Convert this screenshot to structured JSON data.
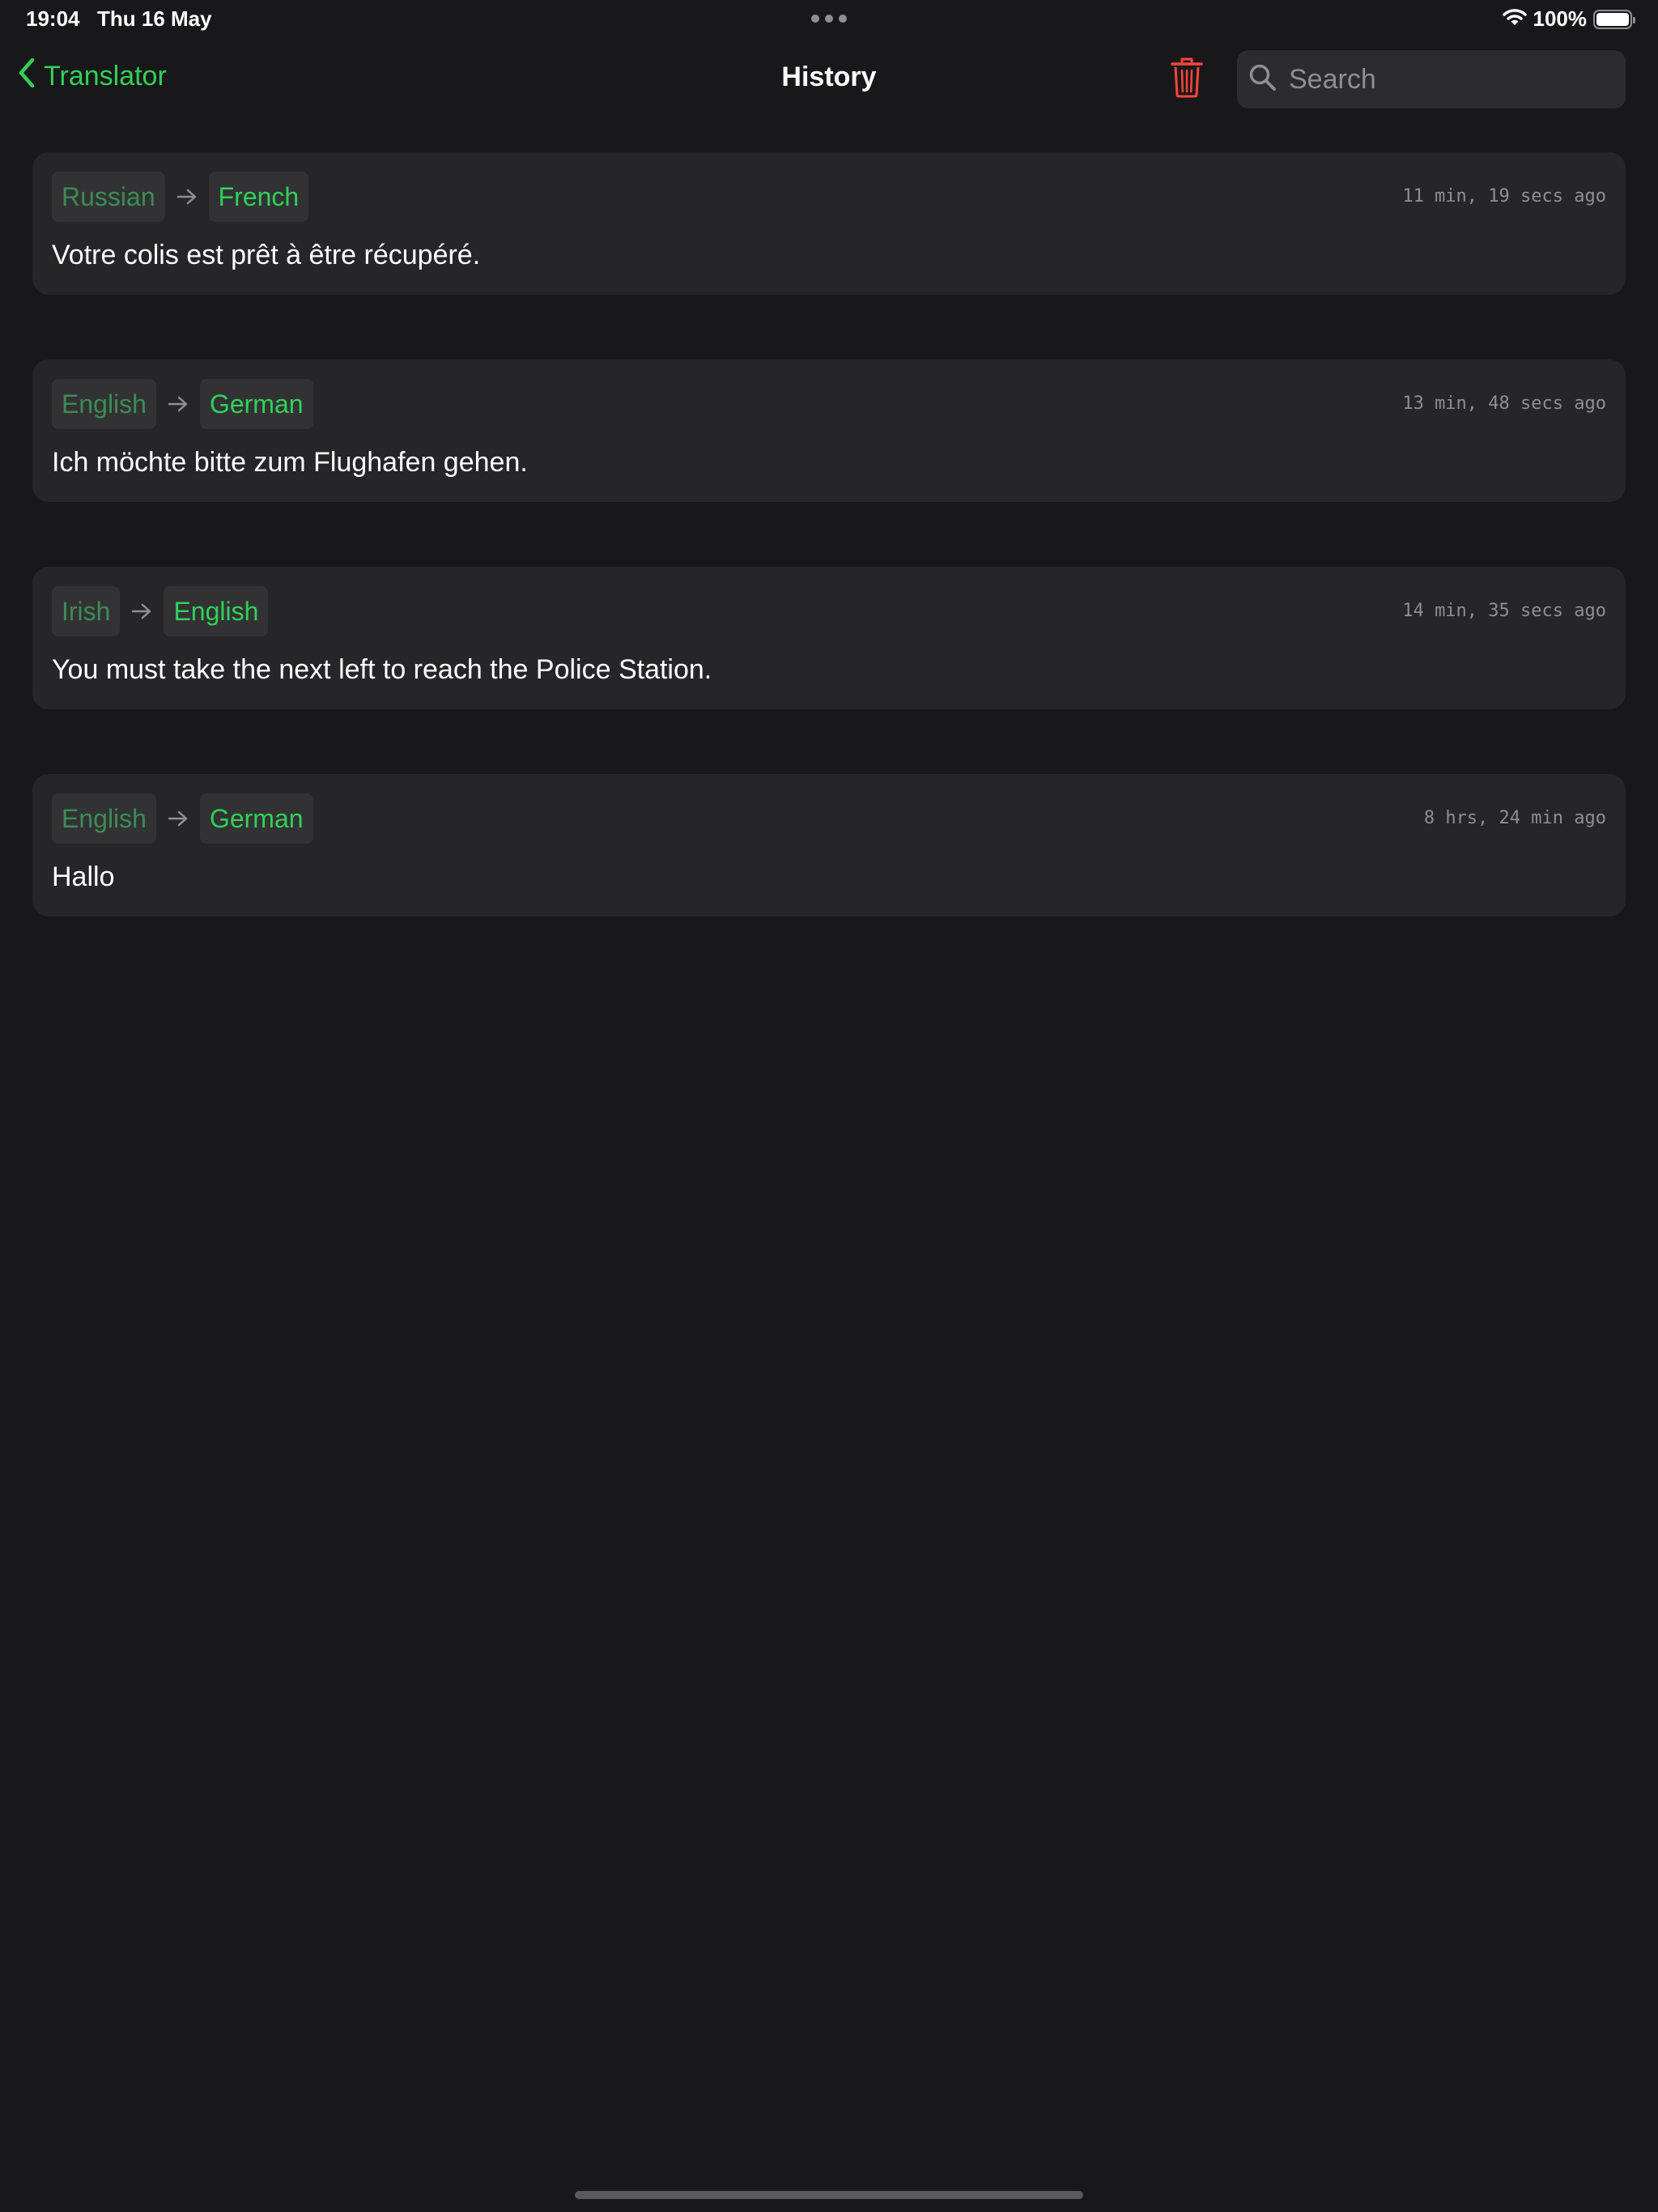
{
  "status_bar": {
    "time": "19:04",
    "date": "Thu 16 May",
    "battery": "100%",
    "icons": [
      "wifi-icon",
      "battery-icon"
    ]
  },
  "nav": {
    "back_label": "Translator",
    "title": "History",
    "search_placeholder": "Search",
    "search_value": "",
    "icons": [
      "chevron-left-icon",
      "trash-icon",
      "search-icon"
    ]
  },
  "colors": {
    "accent": "#30d158",
    "source_language": "#3c8c55",
    "destructive": "#ff453a",
    "background": "#18181a",
    "card": "#262628"
  },
  "history": [
    {
      "source": "Russian",
      "target": "French",
      "time": "11 min, 19 secs ago",
      "text": "Votre colis est prêt à être récupéré."
    },
    {
      "source": "English",
      "target": "German",
      "time": "13 min, 48 secs ago",
      "text": "Ich möchte bitte zum Flughafen gehen."
    },
    {
      "source": "Irish",
      "target": "English",
      "time": "14 min, 35 secs ago",
      "text": "You must take the next left to reach the Police Station."
    },
    {
      "source": "English",
      "target": "German",
      "time": "8 hrs, 24 min ago",
      "text": "Hallo"
    }
  ]
}
